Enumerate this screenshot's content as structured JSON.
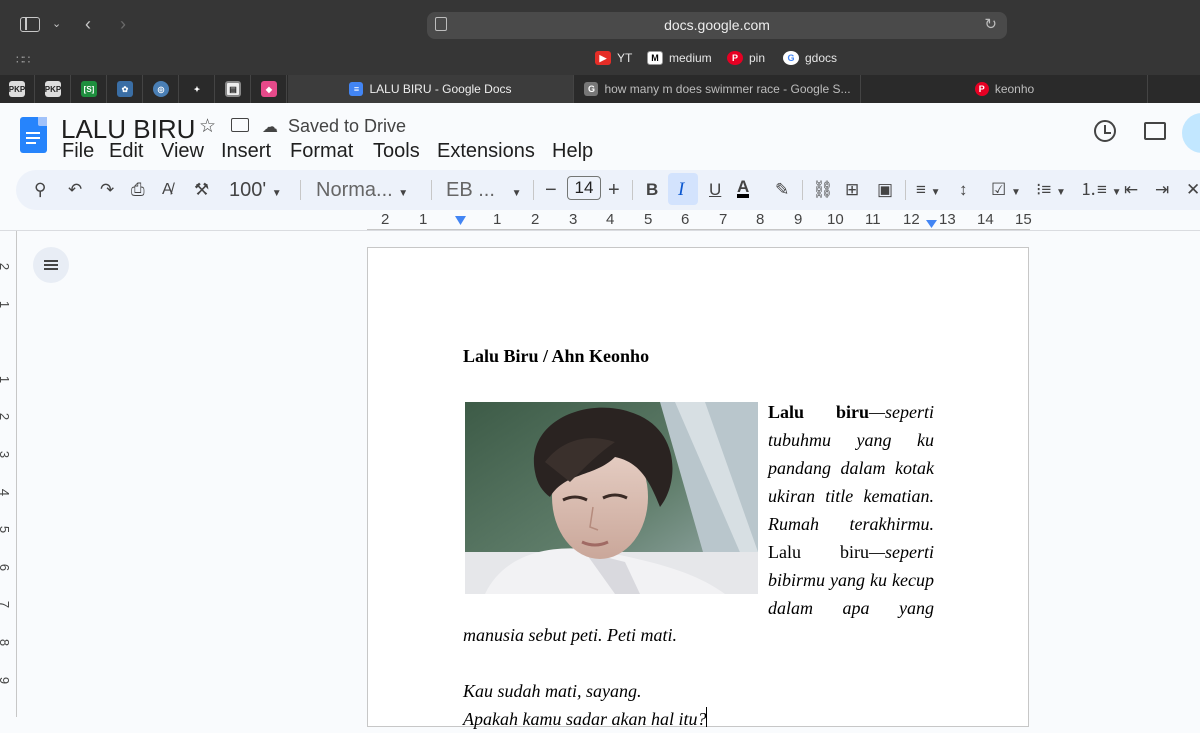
{
  "browser": {
    "url": "docs.google.com",
    "bookmarks": [
      {
        "label": "YT",
        "icon": "youtube-icon"
      },
      {
        "label": "medium",
        "icon": "medium-icon"
      },
      {
        "label": "pin",
        "icon": "pinterest-icon"
      },
      {
        "label": "gdocs",
        "icon": "google-icon"
      }
    ],
    "pinned_tabs": [
      "PKP",
      "PKP",
      "[S]",
      "",
      "",
      "",
      "",
      ""
    ],
    "tabs": [
      {
        "label": "LALU BIRU - Google Docs",
        "icon_text": ""
      },
      {
        "label": "how many m does swimmer race - Google S...",
        "icon_text": "G"
      },
      {
        "label": "keonho",
        "icon_text": "P"
      }
    ]
  },
  "docs": {
    "title": "LALU BIRU",
    "save_status": "Saved to Drive",
    "menus": [
      "File",
      "Edit",
      "View",
      "Insert",
      "Format",
      "Tools",
      "Extensions",
      "Help"
    ],
    "toolbar": {
      "zoom": "100'",
      "style": "Norma...",
      "font": "EB ...",
      "font_size": "14",
      "bold": "B",
      "italic": "I",
      "underline": "U"
    },
    "ruler_numbers": [
      "2",
      "1",
      "1",
      "2",
      "3",
      "4",
      "5",
      "6",
      "7",
      "8",
      "9",
      "10",
      "11",
      "12",
      "13",
      "14",
      "15"
    ],
    "vruler_numbers": [
      "2",
      "1",
      "1",
      "2",
      "3",
      "4",
      "5",
      "6",
      "7",
      "8",
      "9"
    ]
  },
  "document": {
    "heading": "Lalu Biru / Ahn Keonho",
    "line1_bold": "Lalu biru",
    "line1_italic": "—seperti",
    "lines": [
      "tubuhmu yang ku",
      "pandang dalam kotak",
      "ukiran title kematian.",
      "Rumah terakhirmu."
    ],
    "line6_plain": "Lalu biru",
    "line6_italic": "—seperti",
    "lines2": [
      "bibirmu yang ku kecup",
      "dalam apa yang"
    ],
    "after_wrap": "manusia sebut peti. Peti mati.",
    "para2_line1": "Kau sudah mati, sayang.",
    "para2_line2": "Apakah kamu sadar akan hal itu?"
  },
  "colors": {
    "chrome_bg": "#363636",
    "docs_blue": "#2684fc",
    "toolbar_bg": "#edf2fa",
    "active_bg": "#d3e3fd"
  }
}
